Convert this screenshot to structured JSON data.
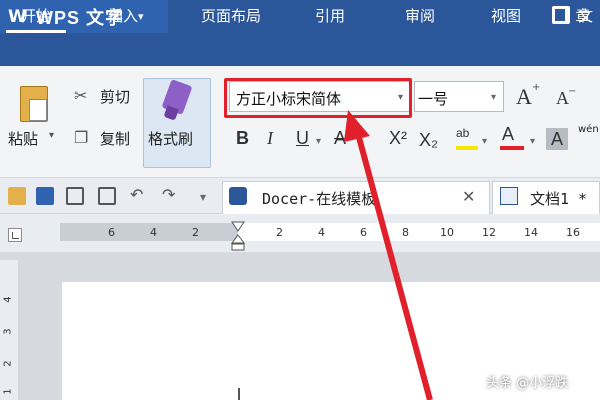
{
  "app": {
    "logo_glyph": "W",
    "title": "WPS 文字",
    "title_caret": "▾",
    "doc_title_partial": "文"
  },
  "menu": {
    "tabs": [
      "开始",
      "插入",
      "页面布局",
      "引用",
      "审阅",
      "视图",
      "章"
    ],
    "active": "开始"
  },
  "ribbon": {
    "paste_label": "粘贴",
    "cut_label": "剪切",
    "copy_label": "复制",
    "format_painter_label": "格式刷",
    "font_name": "方正小标宋简体",
    "font_size": "一号",
    "grow_font": "A",
    "shrink_font": "A",
    "bold": "B",
    "italic": "I",
    "underline": "U",
    "strikethrough": "A",
    "superscript": "X²",
    "subscript": "X₂",
    "highlight_label": "ab",
    "font_color_label": "A",
    "char_shading_label": "A",
    "phonetic_label": "wén",
    "colors": {
      "highlight": "#f5e800",
      "font_color": "#e0202a",
      "annotation_red": "#e0202a"
    }
  },
  "tabs": {
    "docer_label": "Docer-在线模板",
    "doc_label": "文档1 *",
    "close_glyph": "✕"
  },
  "ruler": {
    "left_ticks": [
      "6",
      "4",
      "2"
    ],
    "right_ticks": [
      "2",
      "4",
      "6",
      "8",
      "10",
      "12",
      "14",
      "16"
    ],
    "vertical_ticks": [
      "4",
      "3",
      "2",
      "1"
    ]
  },
  "watermark": "头条 @小浮跌"
}
